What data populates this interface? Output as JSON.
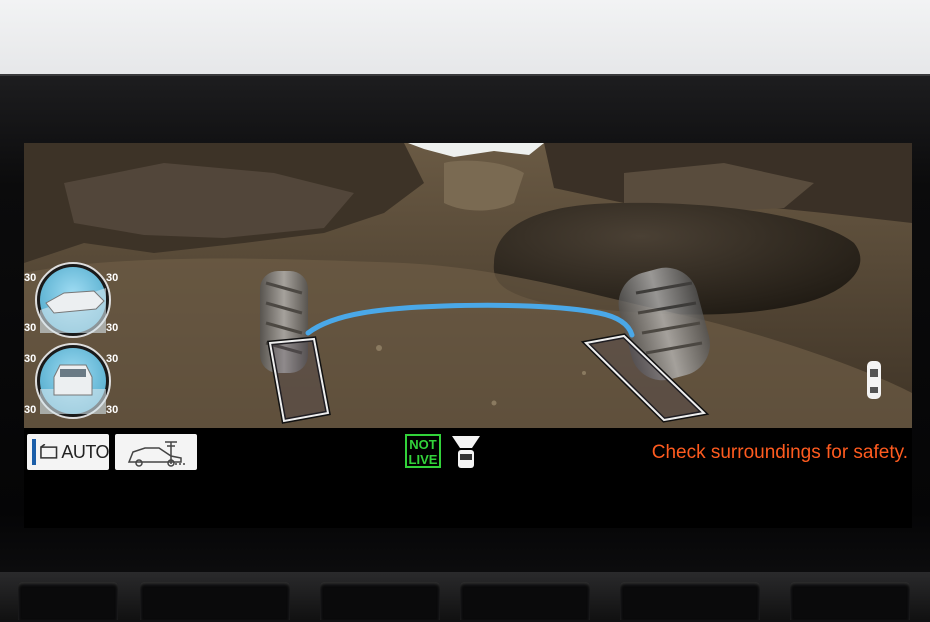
{
  "buttons": {
    "auto_label": "AUTO"
  },
  "status": {
    "not_live_line1": "NOT",
    "not_live_line2": "LIVE"
  },
  "warning": "Check surroundings for safety.",
  "gauges": {
    "pitch": {
      "top_left": "30",
      "top_right": "30",
      "bottom_left": "30",
      "bottom_right": "30"
    },
    "roll": {
      "top_left": "30",
      "top_right": "30",
      "bottom_left": "30",
      "bottom_right": "30"
    }
  },
  "colors": {
    "guide_line": "#4aa8e8",
    "not_live": "#32d23a",
    "warning": "#ff5b1f",
    "auto_stripe": "#1b5ea8"
  },
  "icons": {
    "auto_button": "camera-frame-icon",
    "side_button": "side-view-car-icon",
    "front_cam": "front-camera-car-icon",
    "vehicle_position": "top-down-car-icon"
  }
}
